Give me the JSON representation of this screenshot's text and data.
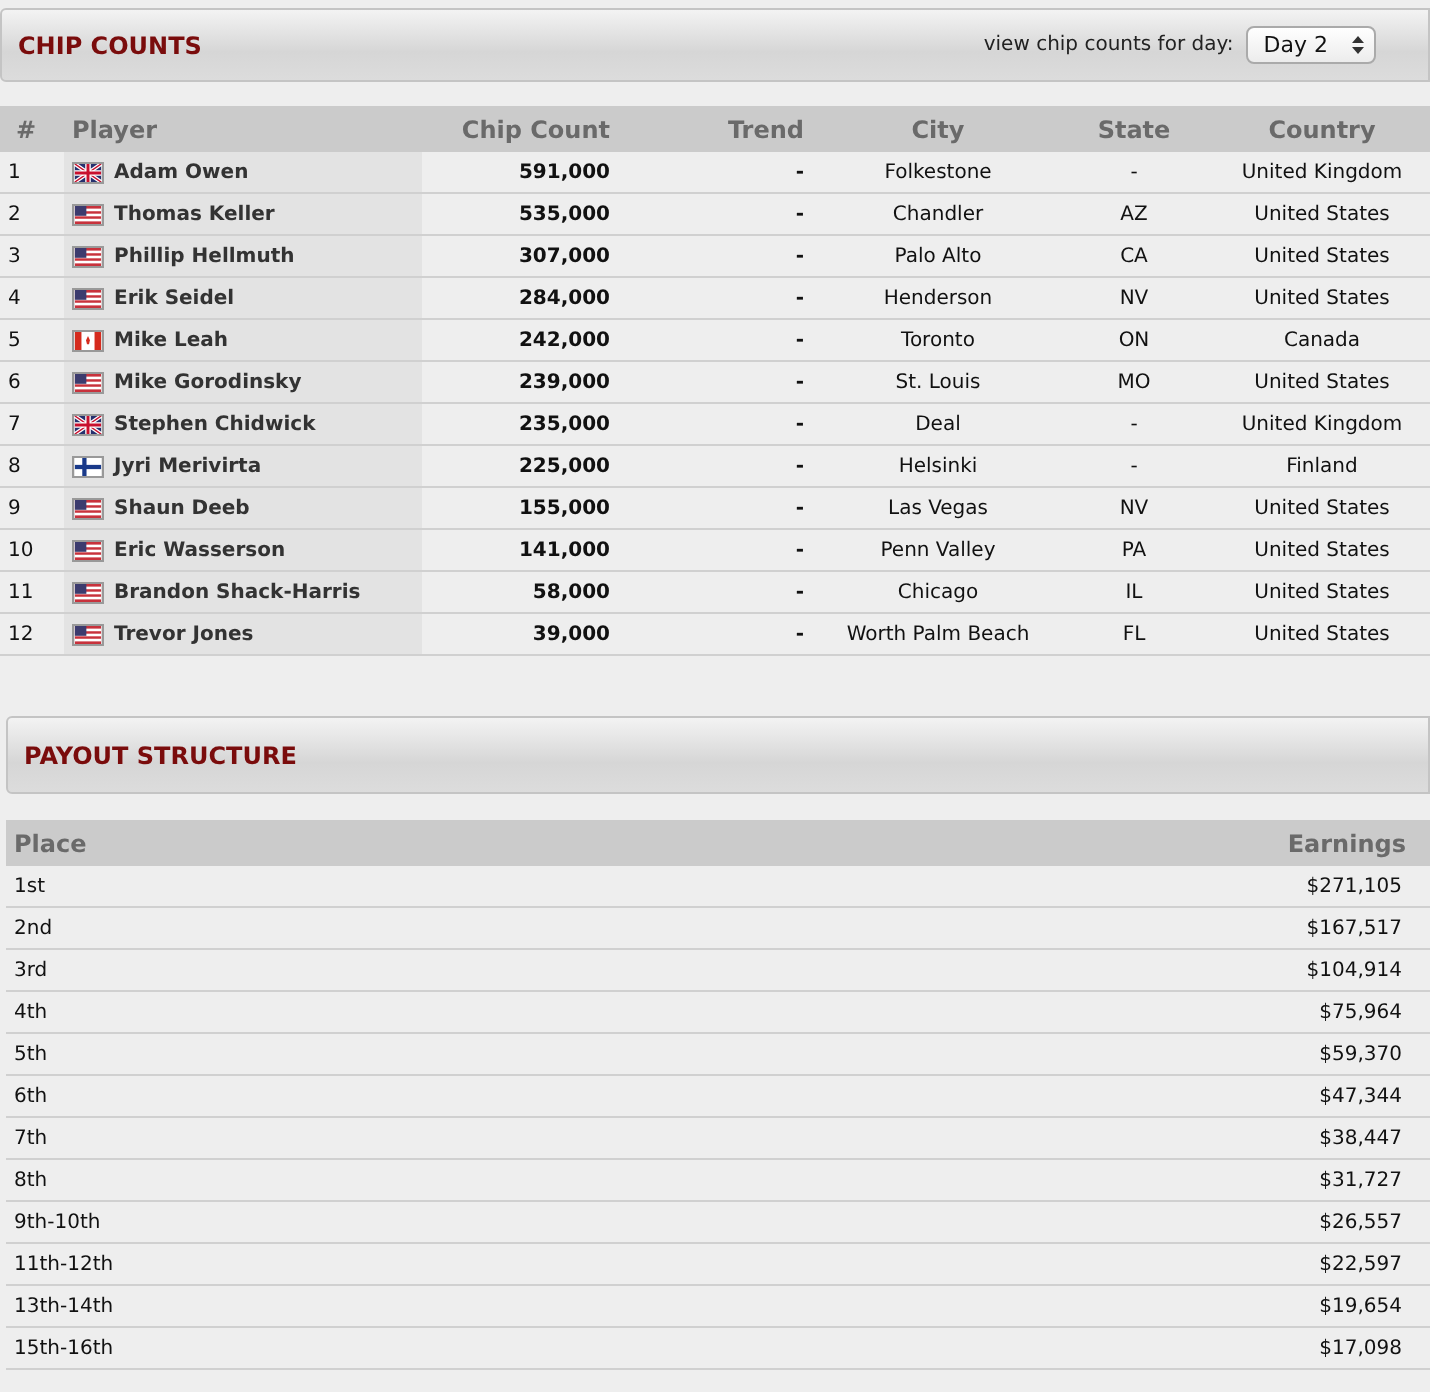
{
  "chip_counts": {
    "title": "CHIP COUNTS",
    "day_label": "view chip counts for day:",
    "day_select": "Day 2",
    "columns": [
      "#",
      "Player",
      "Chip Count",
      "Trend",
      "City",
      "State",
      "Country"
    ],
    "rows": [
      {
        "rank": "1",
        "kind": "uk",
        "player": "Adam Owen",
        "chips": "591,000",
        "trend": "-",
        "city": "Folkestone",
        "state": "-",
        "country": "United Kingdom"
      },
      {
        "rank": "2",
        "kind": "us",
        "player": "Thomas Keller",
        "chips": "535,000",
        "trend": "-",
        "city": "Chandler",
        "state": "AZ",
        "country": "United States"
      },
      {
        "rank": "3",
        "kind": "us",
        "player": "Phillip Hellmuth",
        "chips": "307,000",
        "trend": "-",
        "city": "Palo Alto",
        "state": "CA",
        "country": "United States"
      },
      {
        "rank": "4",
        "kind": "us",
        "player": "Erik Seidel",
        "chips": "284,000",
        "trend": "-",
        "city": "Henderson",
        "state": "NV",
        "country": "United States"
      },
      {
        "rank": "5",
        "kind": "ca",
        "player": "Mike Leah",
        "chips": "242,000",
        "trend": "-",
        "city": "Toronto",
        "state": "ON",
        "country": "Canada"
      },
      {
        "rank": "6",
        "kind": "us",
        "player": "Mike Gorodinsky",
        "chips": "239,000",
        "trend": "-",
        "city": "St. Louis",
        "state": "MO",
        "country": "United States"
      },
      {
        "rank": "7",
        "kind": "uk",
        "player": "Stephen Chidwick",
        "chips": "235,000",
        "trend": "-",
        "city": "Deal",
        "state": "-",
        "country": "United Kingdom"
      },
      {
        "rank": "8",
        "kind": "fi",
        "player": "Jyri Merivirta",
        "chips": "225,000",
        "trend": "-",
        "city": "Helsinki",
        "state": "-",
        "country": "Finland"
      },
      {
        "rank": "9",
        "kind": "us",
        "player": "Shaun Deeb",
        "chips": "155,000",
        "trend": "-",
        "city": "Las Vegas",
        "state": "NV",
        "country": "United States"
      },
      {
        "rank": "10",
        "kind": "us",
        "player": "Eric Wasserson",
        "chips": "141,000",
        "trend": "-",
        "city": "Penn Valley",
        "state": "PA",
        "country": "United States"
      },
      {
        "rank": "11",
        "kind": "us",
        "player": "Brandon Shack-Harris",
        "chips": "58,000",
        "trend": "-",
        "city": "Chicago",
        "state": "IL",
        "country": "United States"
      },
      {
        "rank": "12",
        "kind": "us",
        "player": "Trevor Jones",
        "chips": "39,000",
        "trend": "-",
        "city": "Worth Palm Beach",
        "state": "FL",
        "country": "United States"
      }
    ]
  },
  "payout_structure": {
    "title": "PAYOUT STRUCTURE",
    "columns": [
      "Place",
      "Earnings"
    ],
    "rows": [
      {
        "place": "1st",
        "earnings": "$271,105"
      },
      {
        "place": "2nd",
        "earnings": "$167,517"
      },
      {
        "place": "3rd",
        "earnings": "$104,914"
      },
      {
        "place": "4th",
        "earnings": "$75,964"
      },
      {
        "place": "5th",
        "earnings": "$59,370"
      },
      {
        "place": "6th",
        "earnings": "$47,344"
      },
      {
        "place": "7th",
        "earnings": "$38,447"
      },
      {
        "place": "8th",
        "earnings": "$31,727"
      },
      {
        "place": "9th-10th",
        "earnings": "$26,557"
      },
      {
        "place": "11th-12th",
        "earnings": "$22,597"
      },
      {
        "place": "13th-14th",
        "earnings": "$19,654"
      },
      {
        "place": "15th-16th",
        "earnings": "$17,098"
      }
    ]
  }
}
